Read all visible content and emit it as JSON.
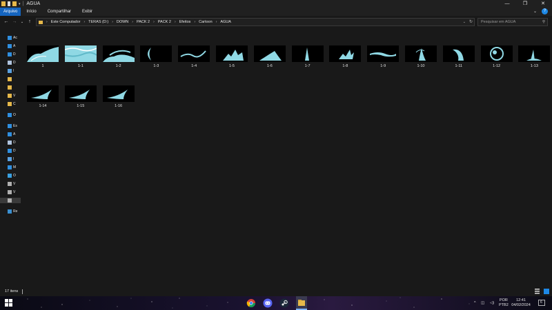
{
  "window": {
    "title": "AGUA",
    "controls": {
      "minimize": "—",
      "maximize": "❐",
      "close": "✕"
    }
  },
  "ribbon": {
    "tabs": [
      {
        "label": "Arquivo",
        "active": true
      },
      {
        "label": "Início",
        "active": false
      },
      {
        "label": "Compartilhar",
        "active": false
      },
      {
        "label": "Exibir",
        "active": false
      }
    ],
    "help_label": "?"
  },
  "navigation": {
    "breadcrumb": [
      "Este Computador",
      "TERAS (D:)",
      "DOWN",
      "PACK 2",
      "PACK 2",
      "Efeitos",
      "Cartoon",
      "AGUA"
    ],
    "search_placeholder": "Pesquisar em AGUA"
  },
  "sidebar": {
    "items": [
      {
        "label": "Ac",
        "icon": "star-icon",
        "color": "#2f8fe0"
      },
      {
        "label": "A",
        "icon": "desktop-icon",
        "color": "#2f8fe0"
      },
      {
        "label": "D",
        "icon": "download-icon",
        "color": "#2f8fe0"
      },
      {
        "label": "D",
        "icon": "document-icon",
        "color": "#b0c4de"
      },
      {
        "label": "I",
        "icon": "image-icon",
        "color": "#5aa0e0"
      },
      {
        "label": "",
        "icon": "folder-icon",
        "color": "#e6b84a"
      },
      {
        "label": "",
        "icon": "folder-icon",
        "color": "#e6b84a"
      },
      {
        "label": "V",
        "icon": "folder-icon",
        "color": "#e6b84a"
      },
      {
        "label": "C",
        "icon": "folder-icon",
        "color": "#e6b84a"
      },
      {
        "label": "O",
        "icon": "cloud-icon",
        "color": "#2f8fe0"
      },
      {
        "label": "Es",
        "icon": "computer-icon",
        "color": "#2f8fe0"
      },
      {
        "label": "A",
        "icon": "desktop-icon",
        "color": "#2f8fe0"
      },
      {
        "label": "D",
        "icon": "document-icon",
        "color": "#b0c4de"
      },
      {
        "label": "D",
        "icon": "download-icon",
        "color": "#2f8fe0"
      },
      {
        "label": "I",
        "icon": "image-icon",
        "color": "#5aa0e0"
      },
      {
        "label": "M",
        "icon": "music-icon",
        "color": "#2f8fe0"
      },
      {
        "label": "O",
        "icon": "cube-icon",
        "color": "#3aa0e0"
      },
      {
        "label": "V",
        "icon": "video-icon",
        "color": "#b0b0b0"
      },
      {
        "label": "V",
        "icon": "drive-icon",
        "color": "#b0b0b0"
      },
      {
        "label": "",
        "icon": "drive-icon",
        "color": "#b0b0b0"
      },
      {
        "label": "Re",
        "icon": "network-icon",
        "color": "#3a8fd0"
      }
    ]
  },
  "files": [
    {
      "name": "1",
      "shape": "wave-big"
    },
    {
      "name": "1-1",
      "shape": "wave-full"
    },
    {
      "name": "1-2",
      "shape": "wave-big2"
    },
    {
      "name": "1-3",
      "shape": "crescent"
    },
    {
      "name": "1-4",
      "shape": "ripple"
    },
    {
      "name": "1-5",
      "shape": "splash"
    },
    {
      "name": "1-6",
      "shape": "mound"
    },
    {
      "name": "1-7",
      "shape": "column"
    },
    {
      "name": "1-8",
      "shape": "burst"
    },
    {
      "name": "1-9",
      "shape": "flat"
    },
    {
      "name": "1-10",
      "shape": "fountain"
    },
    {
      "name": "1-11",
      "shape": "curl"
    },
    {
      "name": "1-12",
      "shape": "ball"
    },
    {
      "name": "1-13",
      "shape": "geyser"
    },
    {
      "name": "1-14",
      "shape": "fin"
    },
    {
      "name": "1-15",
      "shape": "fin"
    },
    {
      "name": "1-16",
      "shape": "fin"
    }
  ],
  "status": {
    "item_count": "17 itens"
  },
  "taskbar": {
    "apps": [
      {
        "name": "chrome-icon"
      },
      {
        "name": "discord-icon"
      },
      {
        "name": "steam-icon"
      },
      {
        "name": "file-explorer-icon"
      }
    ],
    "tray": {
      "language": "POR",
      "layout": "PTB2",
      "time": "12:41",
      "date": "04/02/2024",
      "notification_count": "6"
    }
  },
  "colors": {
    "accent": "#1565c0",
    "water": "#8fd8e4",
    "folder": "#e6b84a"
  }
}
